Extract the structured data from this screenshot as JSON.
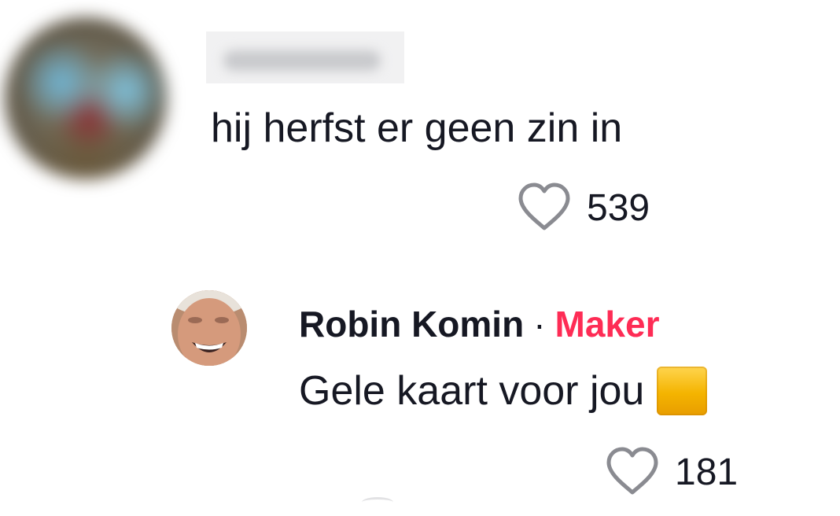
{
  "comment": {
    "text": "hij herfst er geen zin in",
    "likes": "539"
  },
  "reply": {
    "author": "Robin Komin",
    "separator": "·",
    "badge": "Maker",
    "text": "Gele kaart voor jou",
    "likes": "181"
  },
  "icons": {
    "like": "heart-outline-icon",
    "emoji": "yellow-card-icon"
  },
  "colors": {
    "text": "#161823",
    "maker_badge": "#fe2c55",
    "heart_stroke": "#8a8b91"
  }
}
